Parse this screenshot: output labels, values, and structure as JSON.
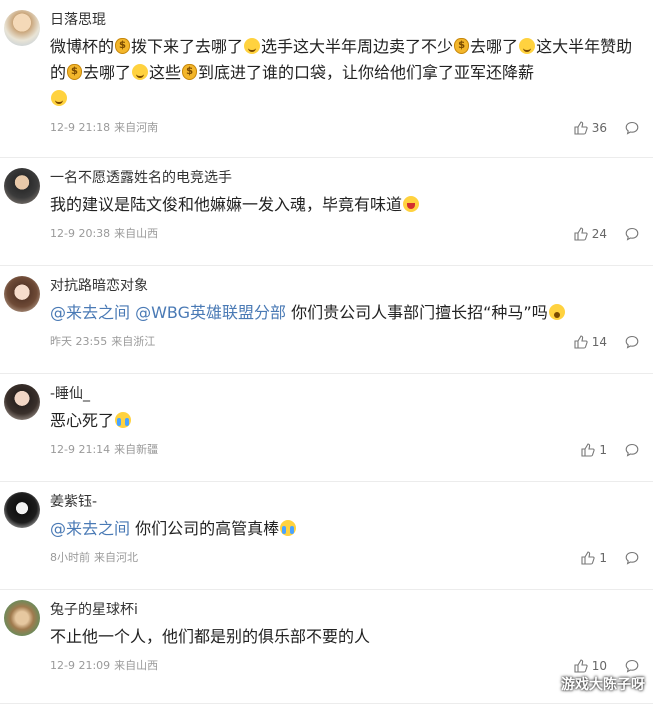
{
  "comments": [
    {
      "username": "日落思琨",
      "text_parts": [
        "微博杯的",
        "拨下来了去哪了",
        "选手这大半年周边卖了不少",
        "去哪了",
        "这大半年赞助的",
        "去哪了",
        "这些",
        "到底进了谁的口袋，让你给他们拿了亚军还降薪"
      ],
      "time": "12-9 21:18",
      "location": "来自河南",
      "likes": "36"
    },
    {
      "username": "一名不愿透露姓名的电竞选手",
      "text": "我的建议是陆文俊和他嫲嫲一发入魂，毕竟有味道",
      "time": "12-9 20:38",
      "location": "来自山西",
      "likes": "24"
    },
    {
      "username": "对抗路暗恋对象",
      "mention1": "@来去之间",
      "mention2": "@WBG英雄联盟分部",
      "text": " 你们贵公司人事部门擅长招“种马”吗",
      "time": "昨天 23:55",
      "location": "来自浙江",
      "likes": "14"
    },
    {
      "username": "-睡仙_",
      "text": "恶心死了",
      "time": "12-9 21:14",
      "location": "来自新疆",
      "likes": "1"
    },
    {
      "username": "姜紫钰-",
      "mention1": "@来去之间",
      "text": " 你们公司的高管真棒",
      "time": "8小时前",
      "location": "来自河北",
      "likes": "1"
    },
    {
      "username": "兔子的星球杯i",
      "text": "不止他一个人，他们都是别的俱乐部不要的人",
      "time": "12-9 21:09",
      "location": "来自山西",
      "likes": "10"
    }
  ],
  "watermark": "游戏大陈子呀",
  "colors": {
    "mention": "#4a7ab5",
    "meta": "#9a9a9a",
    "divider": "#ececec"
  },
  "icons": {
    "like": "thumbs-up-icon",
    "reply": "comment-bubble-icon"
  }
}
